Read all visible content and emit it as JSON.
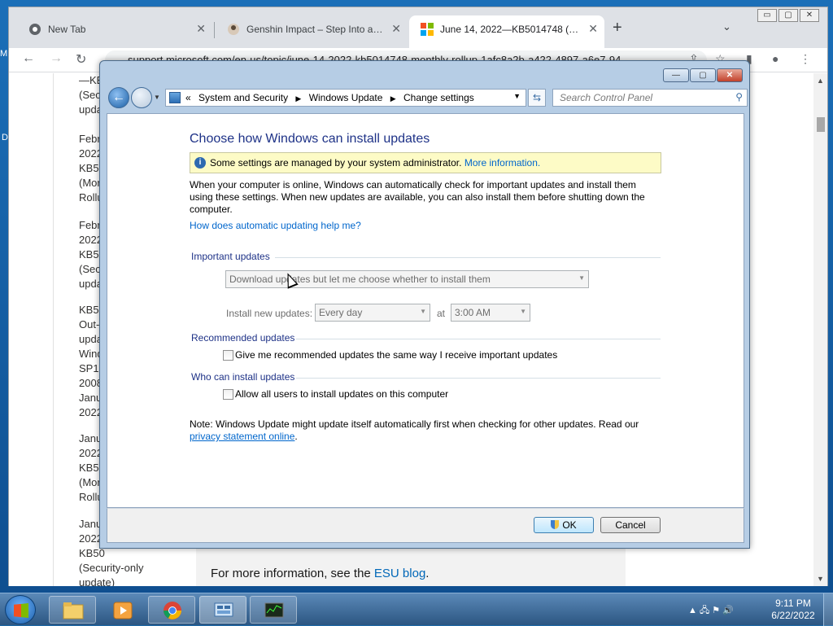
{
  "desktop": {
    "label_a": "M",
    "label_b": "D"
  },
  "browser": {
    "tabs": [
      {
        "title": "New Tab"
      },
      {
        "title": "Genshin Impact – Step Into a Vast"
      },
      {
        "title": "June 14, 2022—KB5014748 (Monthly"
      }
    ],
    "tab_close": "✕",
    "new_tab": "+",
    "tab_search": "⌄",
    "window_controls": [
      "▭",
      "▢",
      "✕"
    ],
    "nav": {
      "back": "←",
      "forward": "→",
      "reload": "↻"
    },
    "url": "support.microsoft.com/en-us/topic/june-14-2022-kb5014748-monthly-rollup-1afc8a2b-a422-4897-a6e7-94",
    "page": {
      "side_items": [
        "—KE\n(Sec\nupda",
        "Febr\n2022\nKB50\n(Mor\nRollu",
        "Febr\n2022\nKB50\n(Secu\nupda",
        "KB50\nOut-\nupda\nWind\nSP1\n2008\nJanua\n2022",
        "Janu\n2022\nKB50\n(Mor\nRollu",
        "Janu\n2022\nKB50\n(Security-only\nupdate)"
      ],
      "esu_text": "For more information, see the ",
      "esu_link": "ESU blog",
      "esu_end": "."
    }
  },
  "dialog": {
    "controls": [
      "—",
      "▢",
      "✕"
    ],
    "breadcrumb": [
      "System and Security",
      "Windows Update",
      "Change settings"
    ],
    "breadcrumb_prefix": "«",
    "search_placeholder": "Search Control Panel",
    "heading": "Choose how Windows can install updates",
    "info_text": "Some settings are managed by your system administrator.",
    "info_link": "More information.",
    "description": "When your computer is online, Windows can automatically check for important updates and install them using these settings. When new updates are available, you can also install them before shutting down the computer.",
    "help_link": "How does automatic updating help me?",
    "important": {
      "title": "Important updates",
      "selected_option": "Download updates but let me choose whether to install them",
      "install_label": "Install new updates:",
      "day": "Every day",
      "at": "at",
      "time": "3:00 AM"
    },
    "recommended": {
      "title": "Recommended updates",
      "checkbox_label": "Give me recommended updates the same way I receive important updates",
      "checked": false
    },
    "who": {
      "title": "Who can install updates",
      "checkbox_label": "Allow all users to install updates on this computer",
      "checked": false
    },
    "note_text": "Note: Windows Update might update itself automatically first when checking for other updates.  Read our",
    "note_link": "privacy statement online",
    "note_end": ".",
    "ok_label": "OK",
    "cancel_label": "Cancel"
  },
  "taskbar": {
    "clock_time": "9:11 PM",
    "clock_date": "6/22/2022",
    "tray_icons": "▲ 🖧 ⚑ 🔊"
  }
}
